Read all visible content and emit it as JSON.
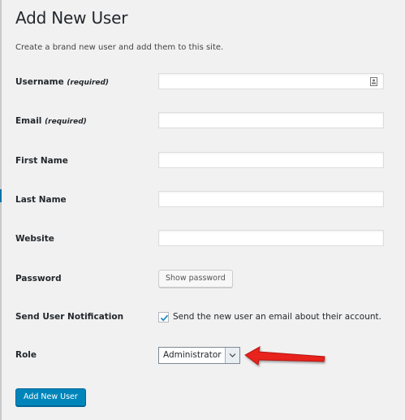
{
  "page": {
    "title": "Add New User",
    "intro": "Create a brand new user and add them to this site."
  },
  "form": {
    "username": {
      "label": "Username",
      "required": "(required)",
      "value": ""
    },
    "email": {
      "label": "Email",
      "required": "(required)",
      "value": ""
    },
    "first_name": {
      "label": "First Name",
      "value": ""
    },
    "last_name": {
      "label": "Last Name",
      "value": ""
    },
    "website": {
      "label": "Website",
      "value": ""
    },
    "password": {
      "label": "Password",
      "button": "Show password"
    },
    "notification": {
      "label": "Send User Notification",
      "checkbox_text": "Send the new user an email about their account.",
      "checked": true
    },
    "role": {
      "label": "Role",
      "selected": "Administrator"
    },
    "submit": "Add New User"
  },
  "icons": {
    "contact": "contact-card-icon",
    "check": "checkmark-icon",
    "dropdown": "chevron-down-icon",
    "pointer": "red-arrow-icon"
  },
  "colors": {
    "primary": "#0085ba",
    "annotation_arrow": "#e8231c",
    "background": "#f1f1f1"
  }
}
